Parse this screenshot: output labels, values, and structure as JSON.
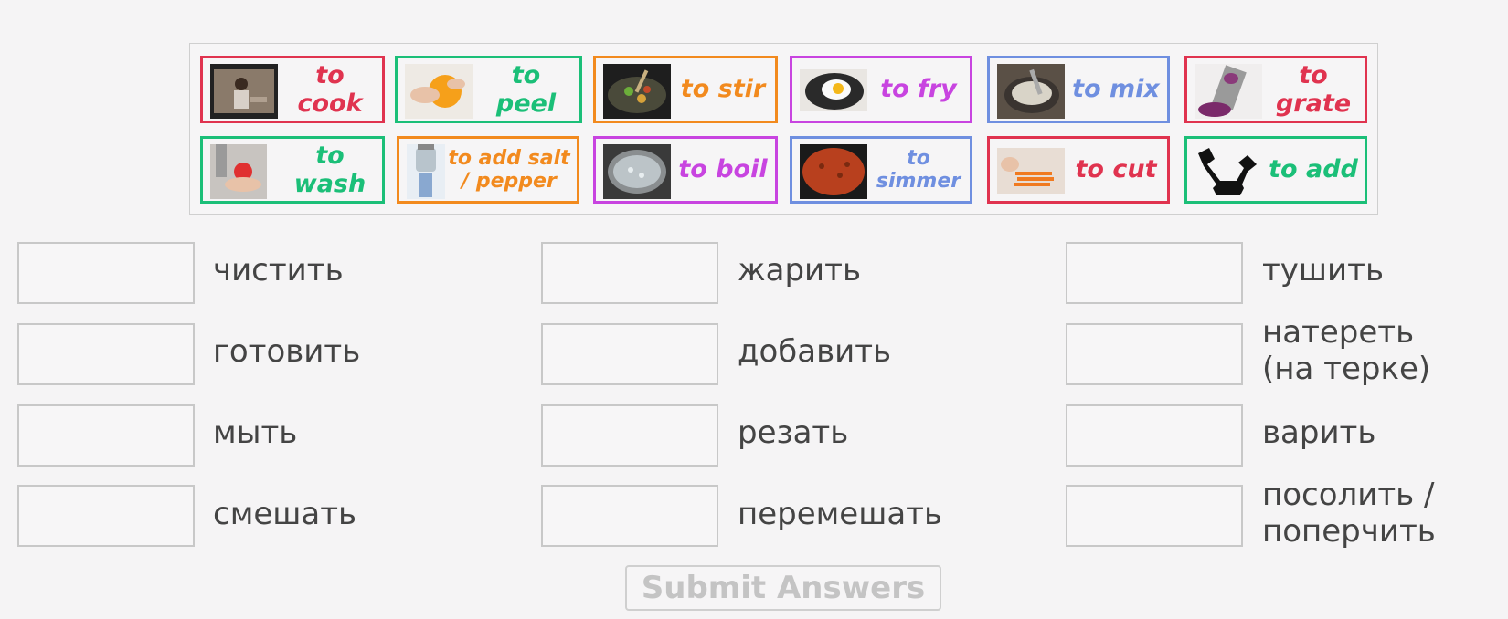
{
  "word_bank": [
    {
      "label": "to cook",
      "color": "#e0334f",
      "icon": "cooking-woman-photo"
    },
    {
      "label": "to peel",
      "color": "#1bbf78",
      "icon": "peeling-orange-photo"
    },
    {
      "label": "to stir",
      "color": "#f28a1e",
      "icon": "stirring-wok-photo"
    },
    {
      "label": "to fry",
      "color": "#c844e0",
      "icon": "fried-egg-pan-photo"
    },
    {
      "label": "to mix",
      "color": "#6f8fe0",
      "icon": "mixing-bowl-photo"
    },
    {
      "label": "to grate",
      "color": "#e0334f",
      "icon": "grater-cabbage-photo"
    },
    {
      "label": "to wash",
      "color": "#1bbf78",
      "icon": "washing-tomato-photo"
    },
    {
      "label": "to add salt\n/ pepper",
      "color": "#f28a1e",
      "icon": "salt-shaker-photo"
    },
    {
      "label": "to boil",
      "color": "#c844e0",
      "icon": "boiling-pot-photo"
    },
    {
      "label": "to\nsimmer",
      "color": "#6f8fe0",
      "icon": "simmering-sauce-photo"
    },
    {
      "label": "to cut",
      "color": "#e0334f",
      "icon": "cutting-carrots-photo"
    },
    {
      "label": "to add",
      "color": "#1bbf78",
      "icon": "adding-pictogram-icon"
    }
  ],
  "targets": [
    {
      "word": "чистить"
    },
    {
      "word": "готовить"
    },
    {
      "word": "мыть"
    },
    {
      "word": "смешать"
    },
    {
      "word": "жарить"
    },
    {
      "word": "добавить"
    },
    {
      "word": "резать"
    },
    {
      "word": "перемешать"
    },
    {
      "word": "тушить"
    },
    {
      "word": "натереть\n(на терке)"
    },
    {
      "word": "варить"
    },
    {
      "word": "посолить /\nпоперчить"
    }
  ],
  "submit_label": "Submit Answers"
}
